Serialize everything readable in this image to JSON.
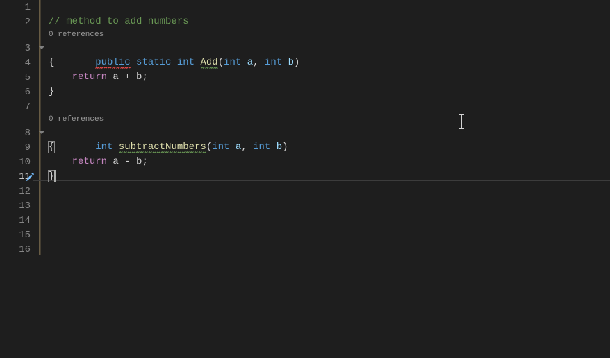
{
  "lines": {
    "n1": "1",
    "n2": "2",
    "n3": "3",
    "n4": "4",
    "n5": "5",
    "n6": "6",
    "n7": "7",
    "n8": "8",
    "n9": "9",
    "n10": "10",
    "n11": "11",
    "n12": "12",
    "n13": "13",
    "n14": "14",
    "n15": "15",
    "n16": "16"
  },
  "codelens": {
    "add": "0 references",
    "subtract": "0 references"
  },
  "code": {
    "comment1a": "// method to add numbers",
    "kw_public": "public",
    "kw_static": "static",
    "type_int": "int",
    "method_add": "Add",
    "param_a": "a",
    "param_b": "b",
    "lparen": "(",
    "rparen": ")",
    "comma_sp": ", ",
    "lbrace": "{",
    "rbrace": "}",
    "kw_return": "return",
    "expr_add": " a + b;",
    "method_sub": "subtractNumbers",
    "expr_sub": " a - b;",
    "space": " "
  }
}
